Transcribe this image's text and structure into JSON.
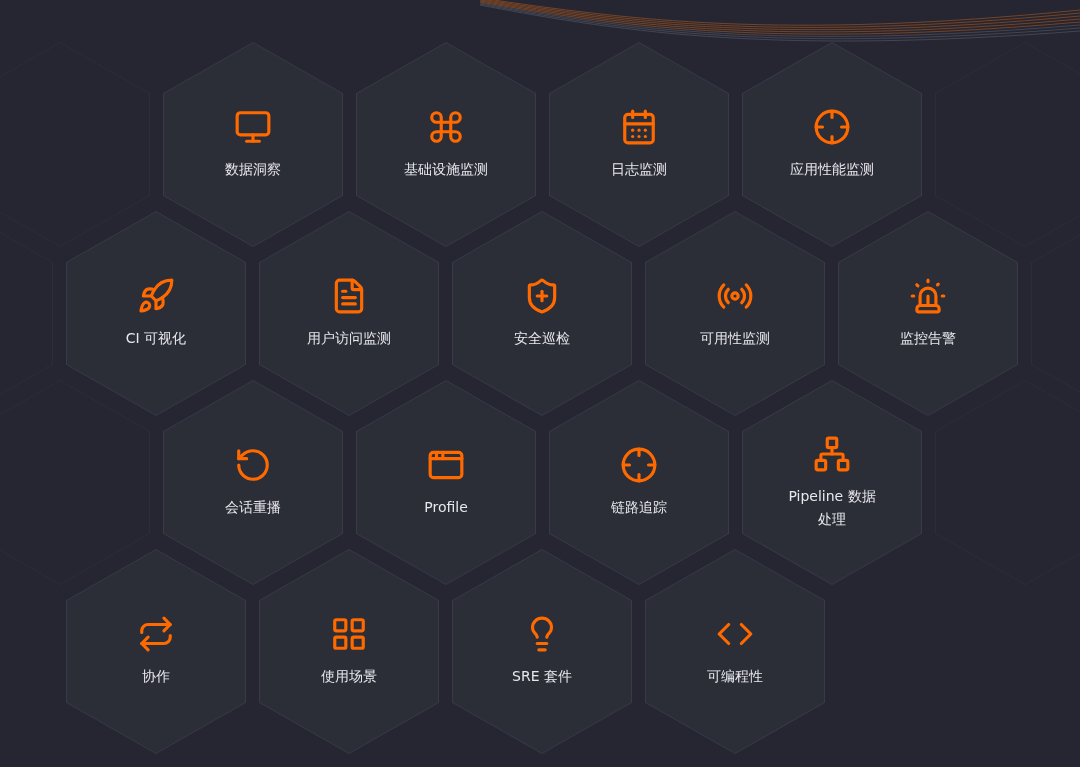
{
  "rows": [
    {
      "items": [
        {
          "label": "数据洞察",
          "kind": "monitor"
        },
        {
          "label": "基础设施监测",
          "kind": "command"
        },
        {
          "label": "日志监测",
          "kind": "calendar"
        },
        {
          "label": "应用性能监测",
          "kind": "crosshair"
        }
      ]
    },
    {
      "items": [
        {
          "label": "CI 可视化",
          "kind": "rocket"
        },
        {
          "label": "用户访问监测",
          "kind": "document"
        },
        {
          "label": "安全巡检",
          "kind": "shield"
        },
        {
          "label": "可用性监测",
          "kind": "radio"
        },
        {
          "label": "监控告警",
          "kind": "siren"
        }
      ]
    },
    {
      "items": [
        {
          "label": "会话重播",
          "kind": "replay"
        },
        {
          "label": "Profile",
          "kind": "window"
        },
        {
          "label": "链路追踪",
          "kind": "crosshair"
        },
        {
          "label": "Pipeline 数据处理",
          "kind": "network"
        }
      ]
    },
    {
      "items": [
        {
          "label": "协作",
          "kind": "repeat"
        },
        {
          "label": "使用场景",
          "kind": "grid"
        },
        {
          "label": "SRE 套件",
          "kind": "bulb"
        },
        {
          "label": "可编程性",
          "kind": "code"
        }
      ]
    }
  ]
}
